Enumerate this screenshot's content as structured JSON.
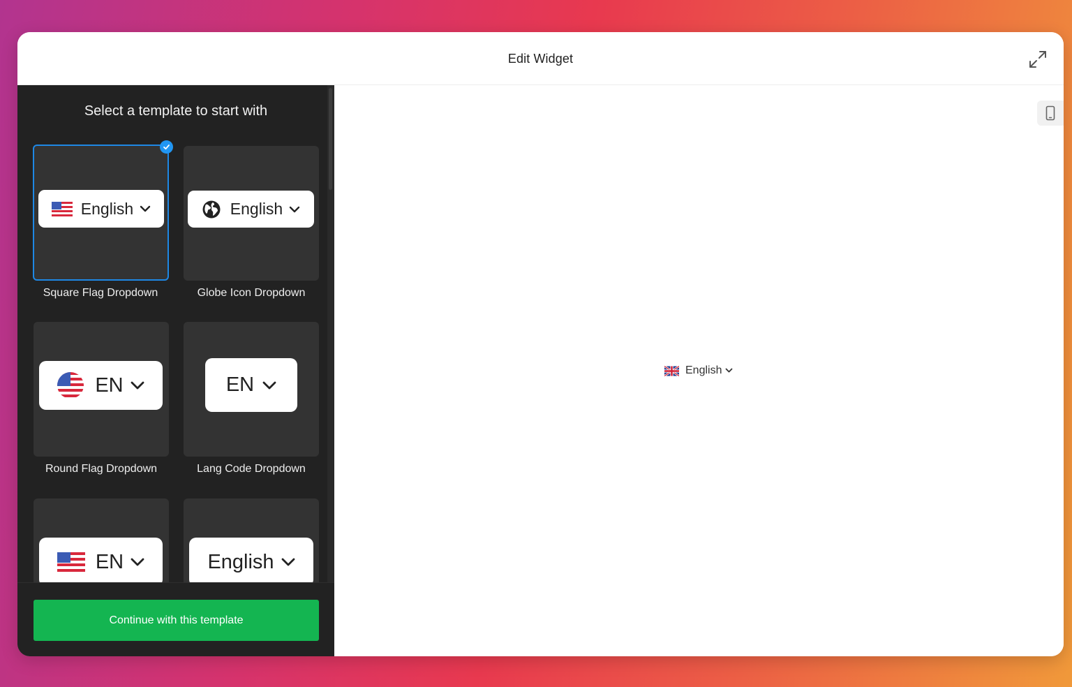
{
  "header": {
    "title": "Edit Widget",
    "expand_icon": "expand-arrows-icon"
  },
  "sidebar": {
    "heading": "Select a template to start with",
    "templates": [
      {
        "label": "Square Flag Dropdown",
        "button_text": "English",
        "icon": "us-flag-square-icon",
        "selected": true
      },
      {
        "label": "Globe Icon Dropdown",
        "button_text": "English",
        "icon": "globe-icon",
        "selected": false
      },
      {
        "label": "Round Flag Dropdown",
        "button_text": "EN",
        "icon": "us-flag-round-icon",
        "selected": false
      },
      {
        "label": "Lang Code Dropdown",
        "button_text": "EN",
        "icon": "",
        "selected": false
      },
      {
        "label": "",
        "button_text": "EN",
        "icon": "us-flag-square-icon",
        "selected": false
      },
      {
        "label": "",
        "button_text": "English",
        "icon": "",
        "selected": false
      }
    ],
    "continue_label": "Continue with this template"
  },
  "preview": {
    "widget_text": "English",
    "widget_flag": "uk-flag-icon",
    "device_toggle_icon": "mobile-device-icon"
  },
  "colors": {
    "selected_border": "#1e88e5",
    "continue_button": "#14b551",
    "panel_background": "#222222",
    "card_background": "#333333"
  }
}
